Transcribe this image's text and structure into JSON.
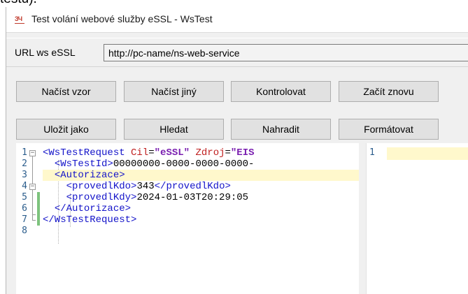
{
  "page": {
    "caption_fragment": "testu)."
  },
  "window": {
    "title": "Test volání webové služby eSSL - WsTest",
    "icon_text": "ЗЧ"
  },
  "url_row": {
    "label": "URL ws eSSL",
    "value": "http://pc-name/ns-web-service"
  },
  "buttons": {
    "load_template": "Načíst vzor",
    "load_other": "Načíst jiný",
    "check": "Kontrolovat",
    "start_over": "Začít znovu",
    "save_as": "Uložit jako",
    "find": "Hledat",
    "replace": "Nahradit",
    "format": "Formátovat"
  },
  "editor": {
    "line_numbers": [
      "1",
      "2",
      "3",
      "4",
      "5",
      "6",
      "7",
      "8"
    ],
    "current_line": 3,
    "changed_lines": [
      4,
      5,
      6
    ],
    "lines": [
      [
        {
          "k": "tag",
          "t": "<WsTestRequest "
        },
        {
          "k": "attr",
          "t": "Cil"
        },
        {
          "k": "txt",
          "t": "="
        },
        {
          "k": "str",
          "t": "\"eSSL\""
        },
        {
          "k": "txt",
          "t": " "
        },
        {
          "k": "attr",
          "t": "Zdroj"
        },
        {
          "k": "txt",
          "t": "="
        },
        {
          "k": "str",
          "t": "\"EIS"
        }
      ],
      [
        {
          "k": "txt",
          "t": "  "
        },
        {
          "k": "tag",
          "t": "<WsTestId>"
        },
        {
          "k": "txt",
          "t": "00000000-0000-0000-0000-"
        }
      ],
      [
        {
          "k": "txt",
          "t": "  "
        },
        {
          "k": "tag",
          "t": "<Autorizace>"
        }
      ],
      [
        {
          "k": "txt",
          "t": "    "
        },
        {
          "k": "tag",
          "t": "<provedlKdo>"
        },
        {
          "k": "txt",
          "t": "343"
        },
        {
          "k": "tag",
          "t": "</provedlKdo>"
        }
      ],
      [
        {
          "k": "txt",
          "t": "    "
        },
        {
          "k": "tag",
          "t": "<provedlKdy>"
        },
        {
          "k": "txt",
          "t": "2024-01-03T20:29:05"
        }
      ],
      [
        {
          "k": "txt",
          "t": "  "
        },
        {
          "k": "tag",
          "t": "</Autorizace>"
        }
      ],
      [
        {
          "k": "tag",
          "t": "</WsTestRequest>"
        }
      ],
      []
    ]
  },
  "result": {
    "line_numbers": [
      "1"
    ]
  }
}
